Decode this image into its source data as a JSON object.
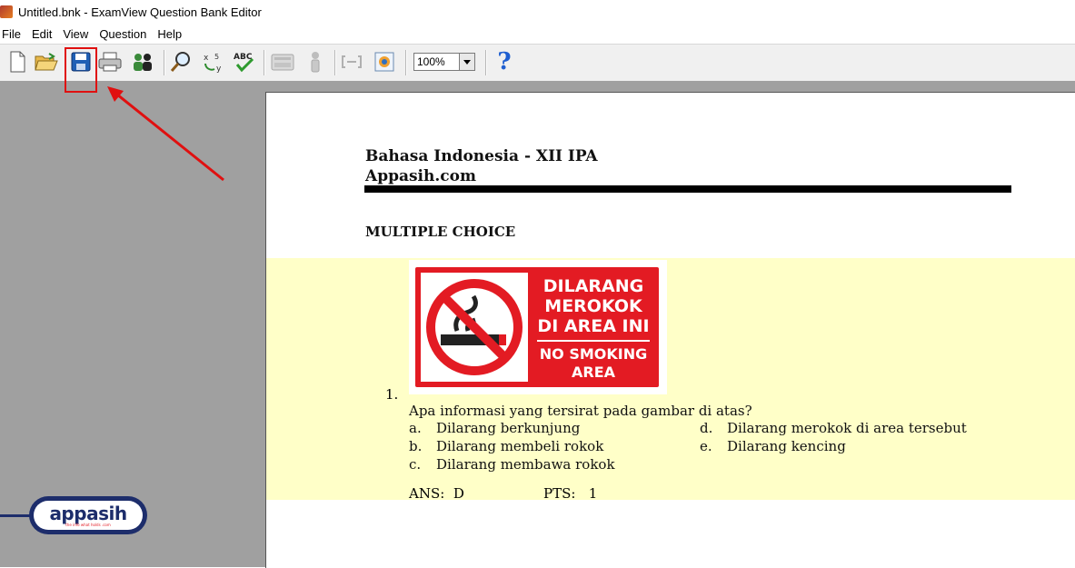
{
  "window": {
    "title": "Untitled.bnk - ExamView Question Bank Editor"
  },
  "menu": [
    "File",
    "Edit",
    "View",
    "Question",
    "Help"
  ],
  "toolbar": {
    "buttons": [
      "new-file-icon",
      "open-folder-icon",
      "save-icon",
      "print-icon",
      "people-icon",
      "find-icon",
      "variables-icon",
      "spell-check-icon",
      "calculator-icon",
      "info-icon",
      "link-icon",
      "color-icon",
      "help-icon"
    ],
    "zoom": "100%",
    "help_glyph": "?"
  },
  "document": {
    "title_line1": "Bahasa Indonesia - XII IPA",
    "title_line2": "Appasih.com",
    "section": "MULTIPLE CHOICE",
    "question": {
      "number": "1.",
      "image": {
        "text_line1": "DILARANG",
        "text_line2": "MEROKOK",
        "text_line3": "DI AREA INI",
        "text_line4": "NO SMOKING",
        "text_line5": "AREA"
      },
      "text": "Apa informasi yang tersirat pada gambar di atas?",
      "choices": [
        {
          "letter": "a.",
          "text": "Dilarang berkunjung"
        },
        {
          "letter": "b.",
          "text": "Dilarang membeli rokok"
        },
        {
          "letter": "c.",
          "text": "Dilarang membawa rokok"
        },
        {
          "letter": "d.",
          "text": "Dilarang merokok di area tersebut"
        },
        {
          "letter": "e.",
          "text": "Dilarang kencing"
        }
      ],
      "ans_label": "ANS:",
      "ans_value": "D",
      "pts_label": "PTS:",
      "pts_value": "1"
    }
  },
  "watermark": {
    "brand": "appasih",
    "tagline": "the info what holds .com"
  },
  "colors": {
    "highlight": "#e01010",
    "band": "#ffffc8",
    "sign_red": "#e31b23"
  }
}
